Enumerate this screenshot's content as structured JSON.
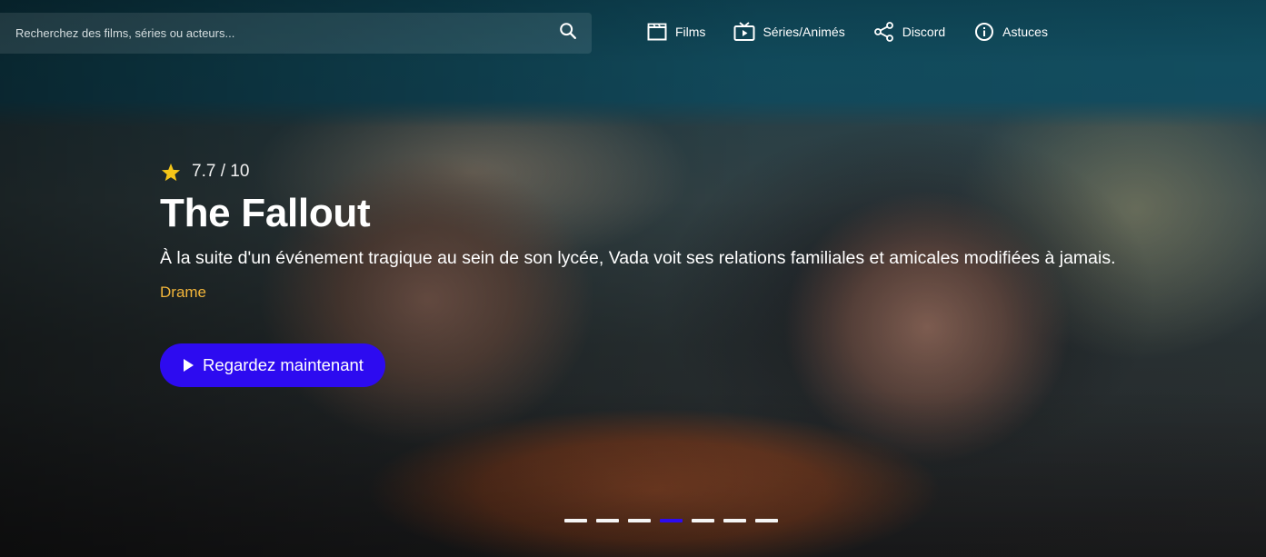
{
  "search": {
    "placeholder": "Recherchez des films, séries ou acteurs...",
    "icon": "search-icon"
  },
  "nav": [
    {
      "label": "Films",
      "icon": "film-clapper-icon"
    },
    {
      "label": "Séries/Animés",
      "icon": "tv-icon"
    },
    {
      "label": "Discord",
      "icon": "share-icon"
    },
    {
      "label": "Astuces",
      "icon": "info-icon"
    }
  ],
  "hero": {
    "rating": "7.7 / 10",
    "title": "The Fallout",
    "synopsis": "À la suite d'un événement tragique au sein de son lycée, Vada voit ses relations familiales et amicales modifiées à jamais.",
    "genre": "Drame",
    "watch_label": "Regardez maintenant"
  },
  "carousel": {
    "count": 7,
    "active_index": 3
  },
  "colors": {
    "accent": "#2d0bf0",
    "genre": "#f2b53a",
    "star": "#f5c518"
  }
}
